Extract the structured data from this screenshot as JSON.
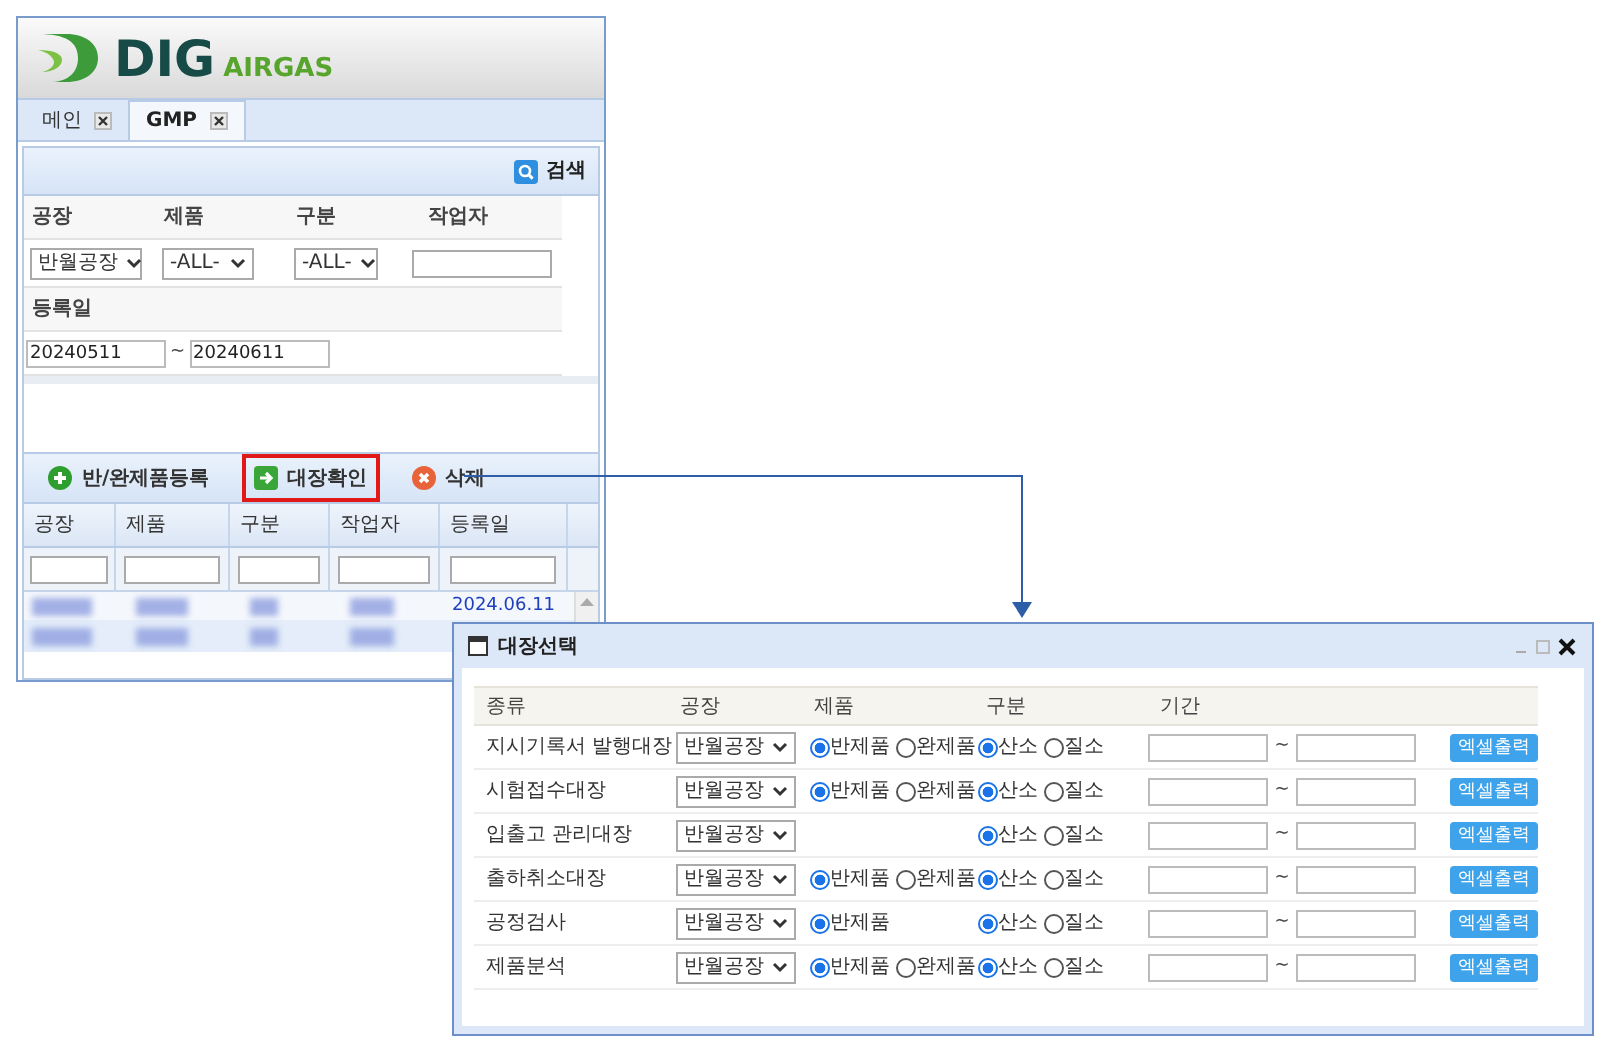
{
  "app": {
    "logo": {
      "brand": "DIG",
      "sub": "AIRGAS"
    },
    "tabs": [
      {
        "label": "메인",
        "selected": false
      },
      {
        "label": "GMP",
        "selected": true
      }
    ],
    "search_button": "검색",
    "filters": {
      "labels": [
        "공장",
        "제품",
        "구분",
        "작업자"
      ],
      "plant": "반월공장",
      "product": "-ALL-",
      "division": "-ALL-",
      "date_label": "등록일",
      "date_from": "20240511",
      "date_sep": "~",
      "date_to": "20240611"
    },
    "toolbar": [
      {
        "label": "반/완제품등록",
        "kind": "add",
        "highlighted": false
      },
      {
        "label": "대장확인",
        "kind": "go",
        "highlighted": true
      },
      {
        "label": "삭제",
        "kind": "delete",
        "highlighted": false
      }
    ],
    "grid": {
      "columns": [
        "공장",
        "제품",
        "구분",
        "작업자",
        "등록일"
      ],
      "visible_date": "2024.06.11"
    }
  },
  "dialog": {
    "title": "대장선택",
    "columns": [
      "종류",
      "공장",
      "제품",
      "구분",
      "기간"
    ],
    "rows": [
      {
        "name": "지시기록서 발행대장",
        "plant": "반월공장",
        "products": [
          {
            "label": "반제품",
            "selected": true
          },
          {
            "label": "완제품",
            "selected": false
          }
        ],
        "divisions": [
          {
            "label": "산소",
            "selected": true
          },
          {
            "label": "질소",
            "selected": false
          }
        ],
        "date_sep": "~",
        "button": "엑셀출력"
      },
      {
        "name": "시험접수대장",
        "plant": "반월공장",
        "products": [
          {
            "label": "반제품",
            "selected": true
          },
          {
            "label": "완제품",
            "selected": false
          }
        ],
        "divisions": [
          {
            "label": "산소",
            "selected": true
          },
          {
            "label": "질소",
            "selected": false
          }
        ],
        "date_sep": "~",
        "button": "엑셀출력"
      },
      {
        "name": "입출고 관리대장",
        "plant": "반월공장",
        "divisions": [
          {
            "label": "산소",
            "selected": true
          },
          {
            "label": "질소",
            "selected": false
          }
        ],
        "date_sep": "~",
        "button": "엑셀출력"
      },
      {
        "name": "출하취소대장",
        "plant": "반월공장",
        "products": [
          {
            "label": "반제품",
            "selected": true
          },
          {
            "label": "완제품",
            "selected": false
          }
        ],
        "divisions": [
          {
            "label": "산소",
            "selected": true
          },
          {
            "label": "질소",
            "selected": false
          }
        ],
        "date_sep": "~",
        "button": "엑셀출력"
      },
      {
        "name": "공정검사",
        "plant": "반월공장",
        "products": [
          {
            "label": "반제품",
            "selected": true
          }
        ],
        "divisions": [
          {
            "label": "산소",
            "selected": true
          },
          {
            "label": "질소",
            "selected": false
          }
        ],
        "date_sep": "~",
        "button": "엑셀출력"
      },
      {
        "name": "제품분석",
        "plant": "반월공장",
        "products": [
          {
            "label": "반제품",
            "selected": true
          },
          {
            "label": "완제품",
            "selected": false
          }
        ],
        "divisions": [
          {
            "label": "산소",
            "selected": true
          },
          {
            "label": "질소",
            "selected": false
          }
        ],
        "date_sep": "~",
        "button": "엑셀출력"
      }
    ]
  }
}
